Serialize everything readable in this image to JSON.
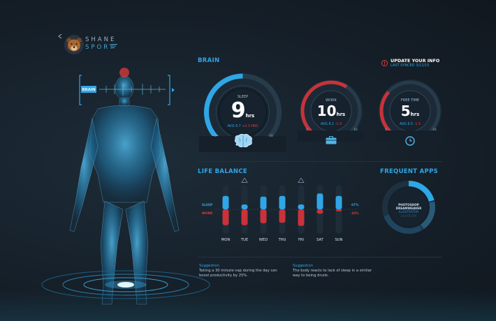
{
  "brand": {
    "line1": "SHANE",
    "line2": "SPORT"
  },
  "body_tag": {
    "label": "BRAIN"
  },
  "section": {
    "brain": "BRAIN",
    "life_balance": "LIFE BALANCE",
    "frequent_apps": "FREQUENT APPS"
  },
  "update": {
    "title": "UPDATE YOUR INFO",
    "subtitle": "LAST SYNCED 3/12/15"
  },
  "gauges": [
    {
      "label": "SLEEP",
      "value": "9",
      "unit": "hrs",
      "avg": "AVG 6.7",
      "delta": "+2.3 HRS",
      "min": "0",
      "max": "16",
      "fill_fraction": 0.5,
      "icon": "brain-icon"
    },
    {
      "label": "WORK",
      "value": "10",
      "unit": "hrs",
      "avg": "AVG 8.1",
      "delta": "-1.9",
      "min": "0",
      "max": "16",
      "fill_fraction": 0.62,
      "icon": "briefcase-icon"
    },
    {
      "label": "FREE TIME",
      "value": "5",
      "unit": "hrs",
      "avg": "AVG 6.5",
      "delta": "-1.5",
      "min": "0",
      "max": "16",
      "fill_fraction": 0.32,
      "icon": "clock-icon"
    }
  ],
  "chart_data": {
    "type": "bar",
    "categories": [
      "MON",
      "TUE",
      "WED",
      "THU",
      "FRI",
      "SAT",
      "SUN"
    ],
    "series": [
      {
        "name": "SLEEP",
        "values": [
          0.55,
          0.2,
          0.52,
          0.55,
          0.2,
          0.65,
          0.55
        ]
      },
      {
        "name": "WORK",
        "values": [
          0.65,
          0.65,
          0.57,
          0.55,
          0.68,
          0.18,
          0.08
        ]
      }
    ],
    "warnings": [
      "TUE",
      "FRI"
    ],
    "legend_left": {
      "sleep": "SLEEP",
      "work": "WORK"
    },
    "legend_right": {
      "sleep": "67%",
      "work": "33%"
    }
  },
  "frequent_apps": {
    "items": [
      "PHOTOSHOP",
      "DREAMWEAVER",
      "ILLUSTRATOR",
      "LIGHTCOM"
    ]
  },
  "suggestions": [
    {
      "title": "Suggestion",
      "text": "Taking a 30 minute nap during the day can boost productivity by 25%."
    },
    {
      "title": "Suggestion",
      "text": "The body reacts to lack of sleep in a similar way to being drunk."
    }
  ],
  "colors": {
    "accent": "#2fa6e6",
    "alert": "#e23b3b",
    "bg": "#16202a"
  }
}
